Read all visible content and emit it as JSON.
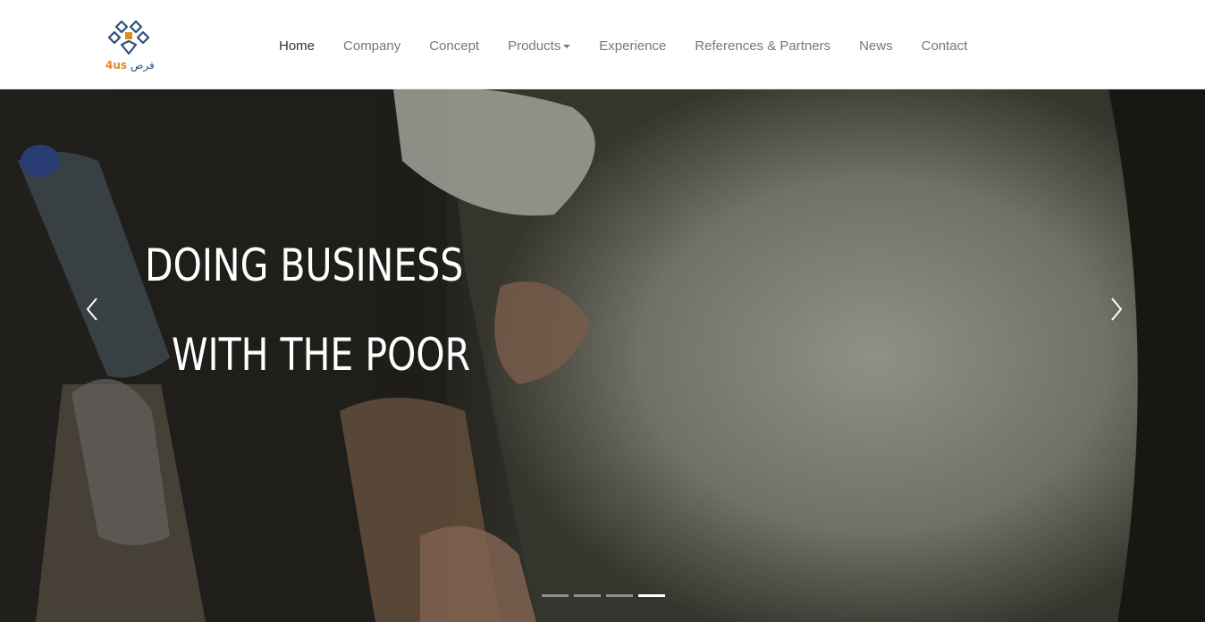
{
  "brand": {
    "logo_text_arabic": "فرص",
    "logo_text_latin": "4us",
    "colors": {
      "blue": "#2f4f7f",
      "orange": "#e08a1e"
    }
  },
  "nav": {
    "items": [
      {
        "label": "Home",
        "active": true
      },
      {
        "label": "Company"
      },
      {
        "label": "Concept"
      },
      {
        "label": "Products",
        "dropdown": true
      },
      {
        "label": "Experience"
      },
      {
        "label": "References & Partners"
      },
      {
        "label": "News"
      },
      {
        "label": "Contact"
      }
    ]
  },
  "hero": {
    "line1": "DOING BUSINESS",
    "line2": "WITH THE POOR",
    "prev_icon": "chevron-left-icon",
    "next_icon": "chevron-right-icon",
    "slide_count": 4,
    "active_slide": 4
  }
}
